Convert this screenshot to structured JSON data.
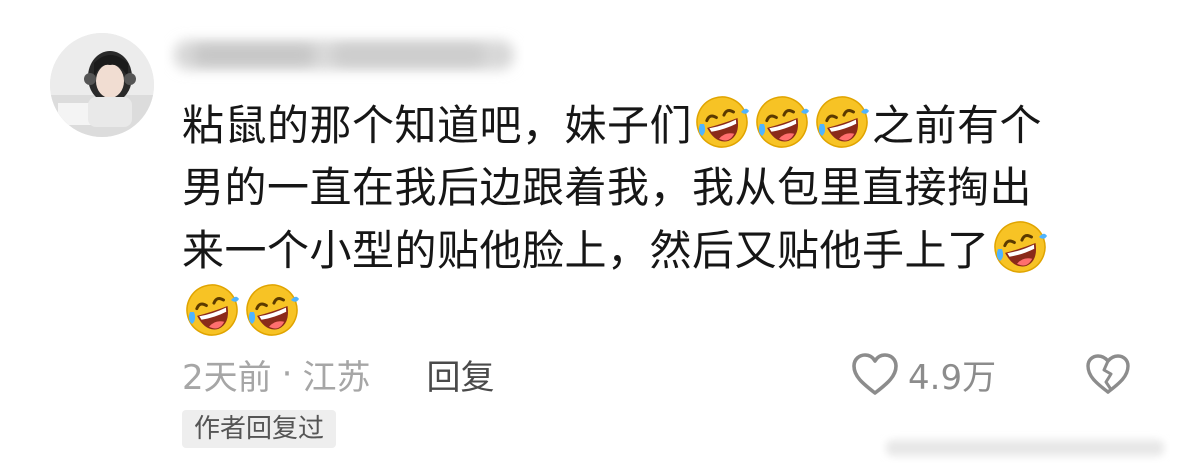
{
  "comment": {
    "lines": [
      [
        "粘鼠的那个知道吧，妹子们",
        "emoji",
        "emoji",
        "emoji",
        "之前有个"
      ],
      [
        "男的一直在我后边跟着我，我从包里直接掏出"
      ],
      [
        "来一个小型的贴他脸上，然后又贴他手上了",
        "emoji"
      ],
      [
        "emoji",
        "emoji"
      ]
    ],
    "line1_text_a": "粘鼠的那个知道吧，妹子们",
    "line1_text_b": "之前有个",
    "line2_text": "男的一直在我后边跟着我，我从包里直接掏出",
    "line3_text": "来一个小型的贴他脸上，然后又贴他手上了",
    "emoji_name": "rolling-on-floor-laughing-emoji"
  },
  "meta": {
    "time": "2天前",
    "separator": "·",
    "location": "江苏",
    "reply_label": "回复"
  },
  "like": {
    "count": "4.9万",
    "icon": "heart-outline-icon"
  },
  "dislike": {
    "icon": "broken-heart-icon"
  },
  "badge": {
    "label": "作者回复过"
  },
  "colors": {
    "text": "#161616",
    "meta": "#a6a6a6",
    "reply": "#4a4a4a",
    "badge_bg": "#eeeeee",
    "emoji_face": "#f7c325"
  }
}
